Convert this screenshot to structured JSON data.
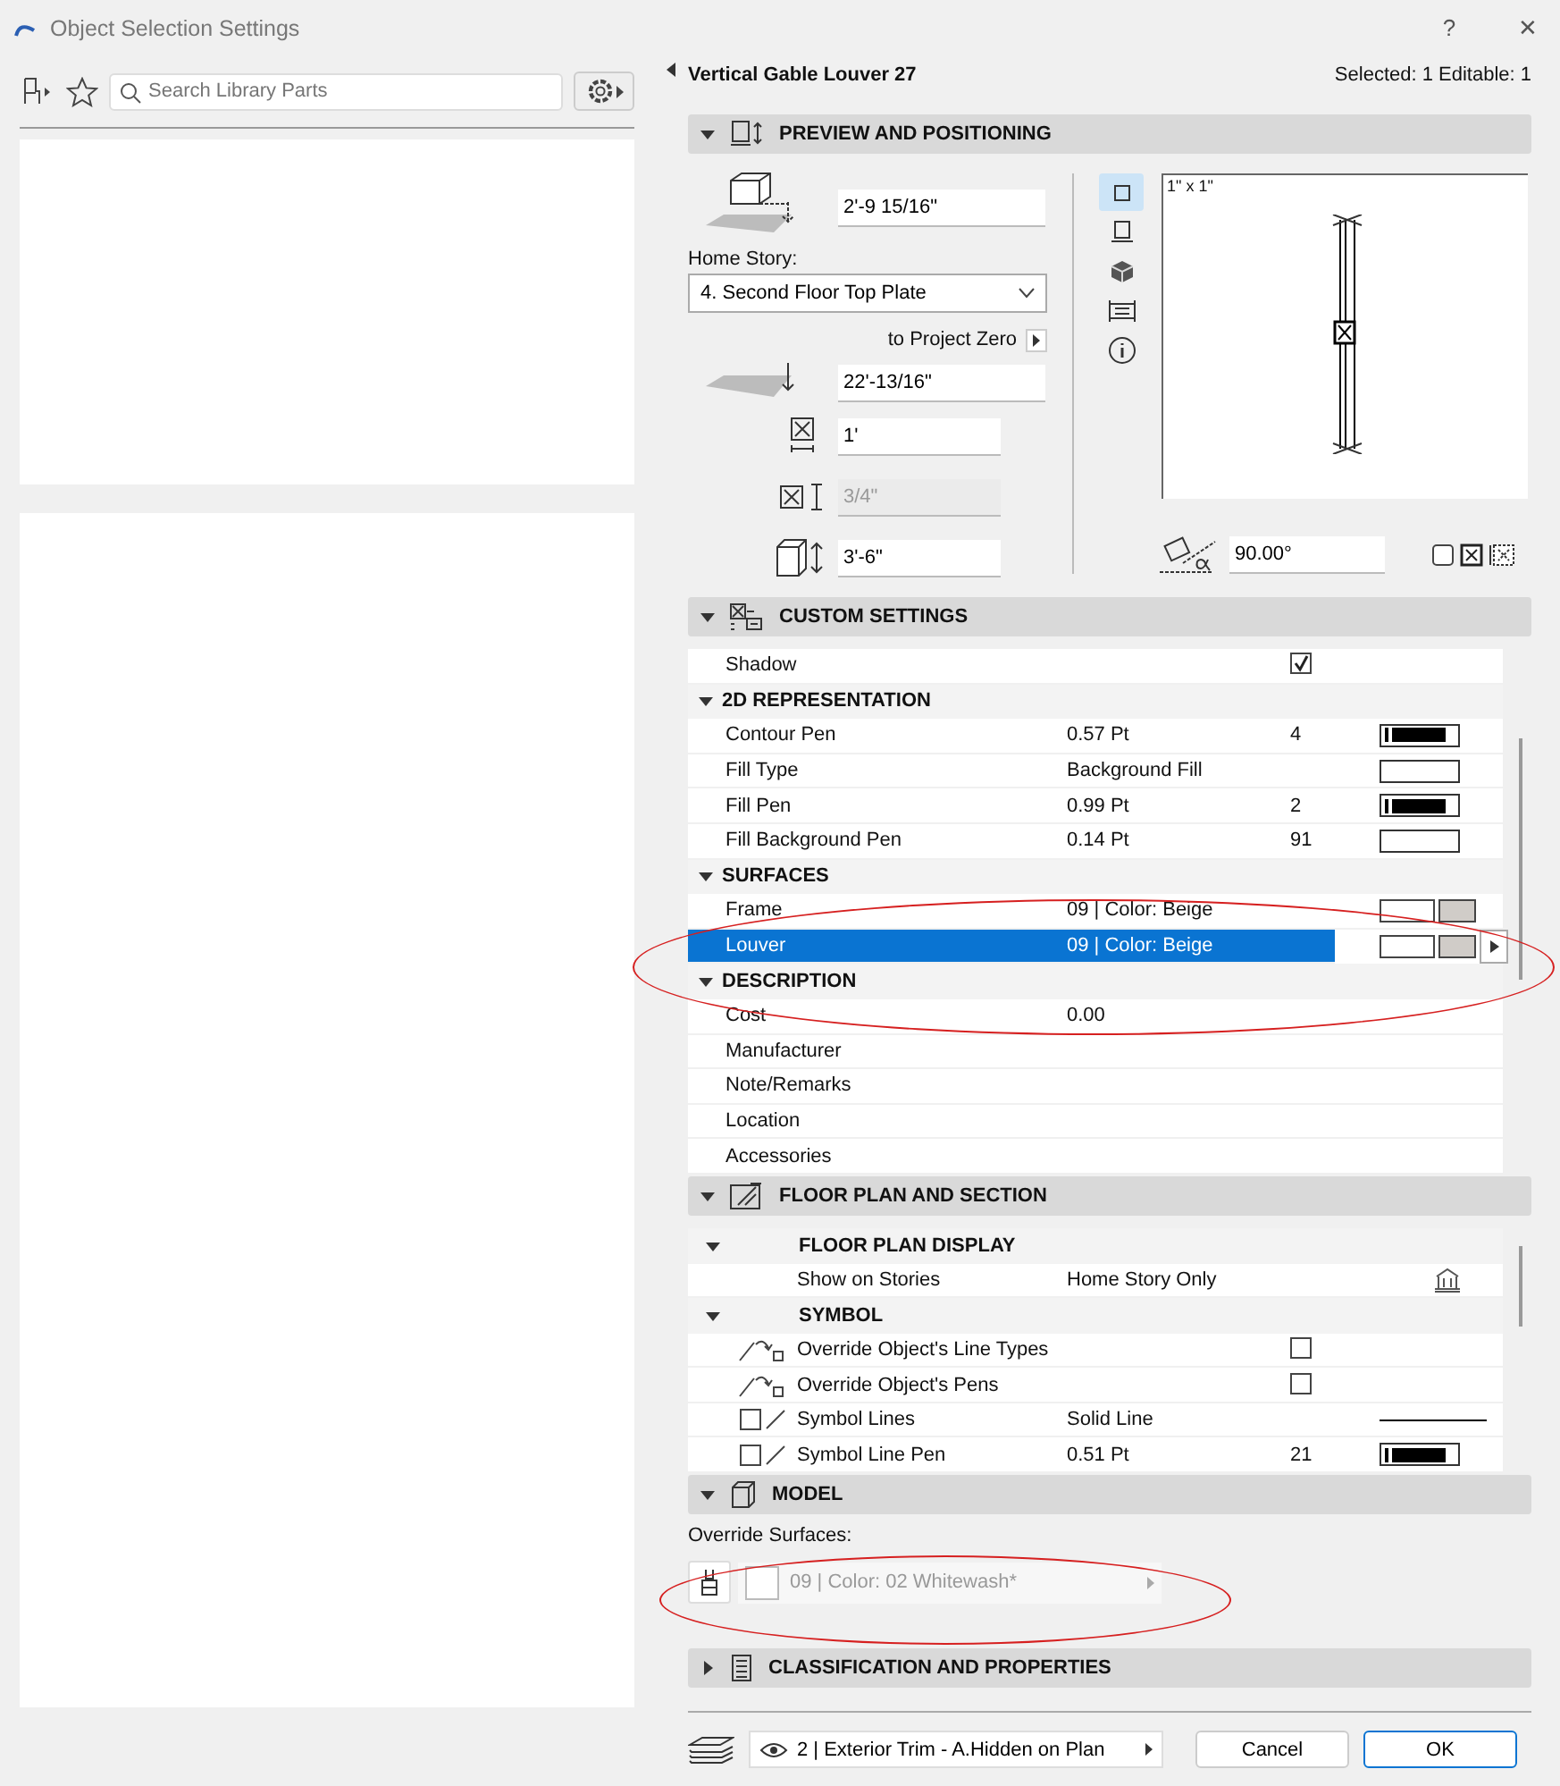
{
  "window": {
    "title": "Object Selection Settings",
    "help": "?",
    "close": "✕"
  },
  "library": {
    "search": {
      "placeholder": "Search Library Parts"
    }
  },
  "header": {
    "object_name": "Vertical Gable Louver 27",
    "selection_info": "Selected: 1 Editable: 1"
  },
  "preview_section": {
    "title": "PREVIEW AND POSITIONING",
    "expanded": true,
    "top_height": "2'-9 15/16\"",
    "home_story_label": "Home Story:",
    "home_story": "4. Second Floor Top Plate",
    "reference": "to Project Zero",
    "elevation": "22'-13/16\"",
    "width": "1'",
    "depth": {
      "value": "3/4\"",
      "disabled": true
    },
    "height": "3'-6\"",
    "preview_label": "1\" x 1\"",
    "angle": "90.00°",
    "view_buttons": [
      {
        "kind": "plan",
        "selected": true
      },
      {
        "kind": "section",
        "selected": false
      },
      {
        "kind": "model",
        "selected": false
      },
      {
        "kind": "list",
        "selected": false
      },
      {
        "kind": "info",
        "selected": false
      }
    ]
  },
  "custom_settings": {
    "title": "CUSTOM SETTINGS",
    "expanded": true,
    "rows": [
      {
        "kind": "check",
        "name": "Shadow",
        "checked": true,
        "selected": false
      },
      {
        "kind": "group",
        "name": "2D REPRESENTATION",
        "expanded": true
      },
      {
        "kind": "param",
        "name": "Contour Pen",
        "value": "0.57 Pt",
        "number": "4",
        "swatch": {
          "kind": "pen"
        },
        "selected": false
      },
      {
        "kind": "param",
        "name": "Fill Type",
        "value": "Background Fill",
        "swatch": {
          "kind": "fill"
        },
        "selected": false
      },
      {
        "kind": "param",
        "name": "Fill Pen",
        "value": "0.99 Pt",
        "number": "2",
        "swatch": {
          "kind": "pen"
        },
        "selected": false
      },
      {
        "kind": "param",
        "name": "Fill Background Pen",
        "value": "0.14 Pt",
        "number": "91",
        "swatch": {
          "kind": "fill"
        },
        "selected": false
      },
      {
        "kind": "group",
        "name": "SURFACES",
        "expanded": true
      },
      {
        "kind": "param",
        "name": "Frame",
        "value": "09 | Color: Beige",
        "swatch": {
          "kind": "surface"
        },
        "selected": false
      },
      {
        "kind": "param",
        "name": "Louver",
        "value": "09 | Color: Beige",
        "swatch": {
          "kind": "surface"
        },
        "selected": true
      },
      {
        "kind": "group",
        "name": "DESCRIPTION",
        "expanded": true
      },
      {
        "kind": "param",
        "name": "Cost",
        "value": "0.00",
        "selected": false
      },
      {
        "kind": "param",
        "name": "Manufacturer",
        "selected": false
      },
      {
        "kind": "param",
        "name": "Note/Remarks",
        "selected": false
      },
      {
        "kind": "param",
        "name": "Location",
        "selected": false
      },
      {
        "kind": "param",
        "name": "Accessories",
        "selected": false
      }
    ]
  },
  "floor_plan_section": {
    "title": "FLOOR PLAN AND SECTION",
    "expanded": true,
    "rows": [
      {
        "kind": "group",
        "name": "FLOOR PLAN DISPLAY",
        "expanded": true
      },
      {
        "kind": "param",
        "name": "Show on Stories",
        "value": "Home Story Only",
        "swatch": {
          "kind": "stories"
        },
        "selected": false
      },
      {
        "kind": "group",
        "name": "SYMBOL",
        "expanded": true
      },
      {
        "kind": "override",
        "name": "Override Object's Line Types",
        "checked": false,
        "selected": false
      },
      {
        "kind": "override",
        "name": "Override Object's Pens",
        "checked": false,
        "selected": false
      },
      {
        "kind": "symbol",
        "name": "Symbol Lines",
        "value": "Solid Line",
        "swatch": {
          "kind": "line"
        },
        "enabled": false,
        "selected": false
      },
      {
        "kind": "symbol",
        "name": "Symbol Line Pen",
        "value": "0.51 Pt",
        "number": "21",
        "swatch": {
          "kind": "pen"
        },
        "enabled": false,
        "selected": false
      }
    ]
  },
  "model_section": {
    "title": "MODEL",
    "expanded": true,
    "label": "Override Surfaces:",
    "surface": {
      "value": "09 | Color: 02 Whitewash*",
      "disabled": true
    }
  },
  "classification_section": {
    "title": "CLASSIFICATION AND PROPERTIES",
    "expanded": false
  },
  "footer": {
    "layer": "2 | Exterior Trim - A.Hidden on Plan",
    "buttons": [
      {
        "label": "Cancel",
        "default": false
      },
      {
        "label": "OK",
        "default": true
      }
    ]
  }
}
